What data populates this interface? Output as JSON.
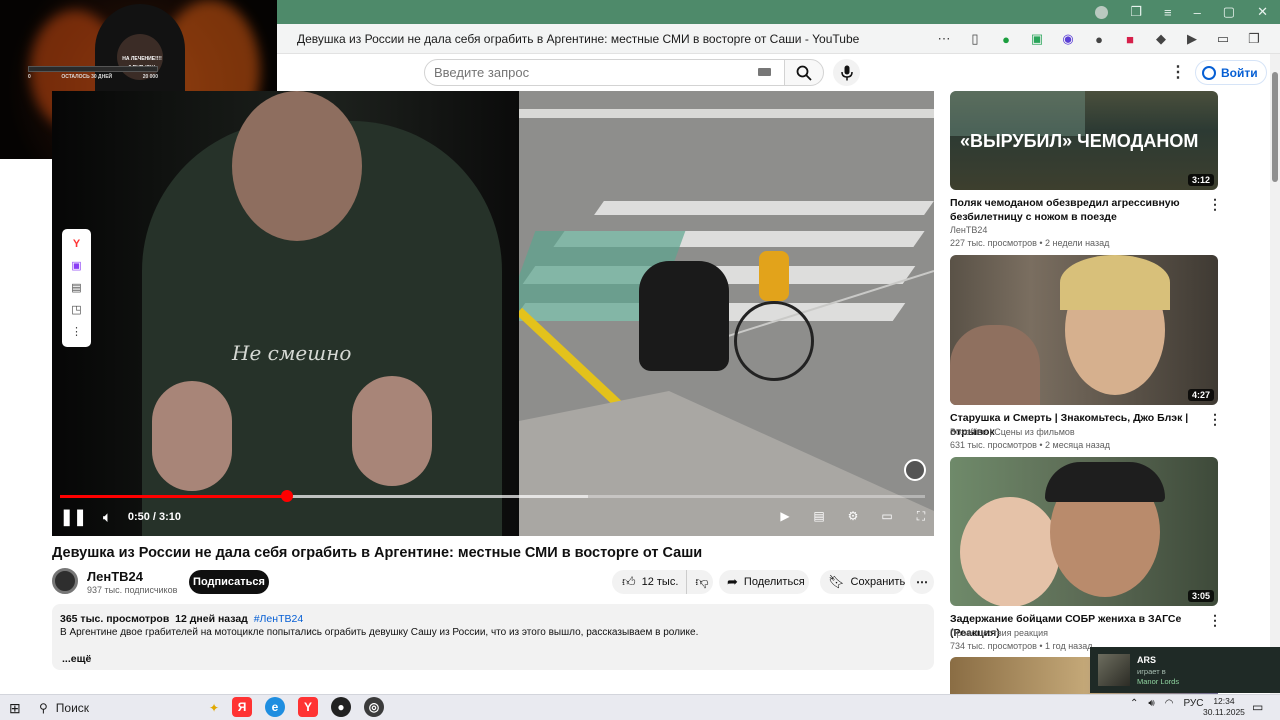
{
  "browser": {
    "tab_title": "Девушка из России не дала себя ограбить в Аргентине: местные СМИ в восторге от Саши - YouTube"
  },
  "overlay": {
    "line1": "НА ЛЕЧЕНИЕ!!!!",
    "line2": "0 RUB (0%)",
    "left_amount": "0",
    "days_left": "ОСТАЛОСЬ 30 ДНЕЙ",
    "goal": "20 000"
  },
  "header": {
    "search_placeholder": "Введите запрос",
    "login_label": "Войти"
  },
  "player": {
    "time_current": "0:50",
    "time_total": "3:10",
    "time_sep": " / ",
    "progress_fraction": 0.263,
    "buffer_fraction": 0.61,
    "hoodie_text": "Не смешно"
  },
  "video": {
    "title": "Девушка из России не дала себя ограбить в Аргентине: местные СМИ в восторге от Саши",
    "channel": "ЛенТВ24",
    "subscribers": "937 тыс. подписчиков",
    "subscribe_label": "Подписаться",
    "likes": "12 тыс.",
    "share_label": "Поделиться",
    "save_label": "Сохранить",
    "views": "365 тыс. просмотров",
    "age": "12 дней назад",
    "hashtag": "#ЛенТВ24",
    "description": "В Аргентине двое грабителей на мотоцикле попытались ограбить девушку Сашу из России, что из этого вышло, рассказываем в ролике.",
    "more_label": "...ещё"
  },
  "recommendations": [
    {
      "thumb_text": "«ВЫРУБИЛ» ЧЕМОДАНОМ",
      "duration": "3:12",
      "title": "Поляк чемоданом обезвредил агрессивную безбилетницу с ножом в поезде",
      "channel": "ЛенТВ24",
      "meta": "227 тыс. просмотров • 2 недели назад"
    },
    {
      "duration": "4:27",
      "title": "Старушка и Смерть | Знакомьтесь, Джо Блэк | отрывок",
      "channel": "Boxoffice | Сцены из фильмов",
      "meta": "631 тыс. просмотров • 2 месяца назад"
    },
    {
      "duration": "3:05",
      "title": "Задержание бойцами СОБР жениха в ЗАГСе (Реакция)",
      "channel": "Происшествия реакция",
      "meta": "734 тыс. просмотров • 1 год назад"
    }
  ],
  "notification": {
    "name": "ARS",
    "playing": "играет в",
    "game": "Manor Lords"
  },
  "taskbar": {
    "search_label": "Поиск",
    "lang": "РУС",
    "time": "12:34",
    "date": "30.11.2025"
  },
  "colors": {
    "yt_red": "#ff0000",
    "link_blue": "#065fd4",
    "window_green": "#4e8a6a"
  }
}
